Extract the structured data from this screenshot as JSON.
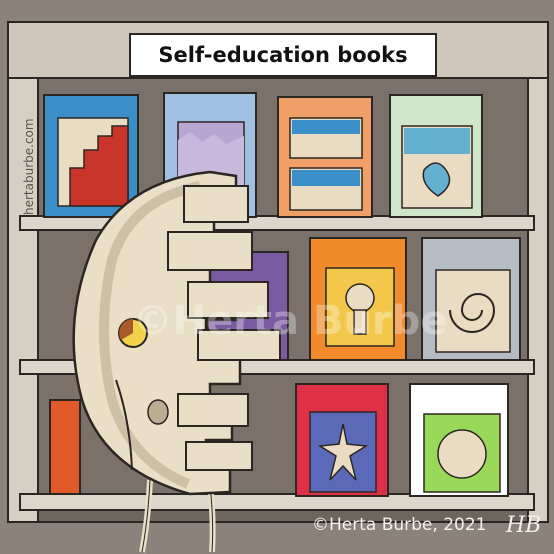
{
  "sign": {
    "title": "Self-education books"
  },
  "credits": {
    "side_url": "hertaburbe.com",
    "watermark": "©Herta Burbe",
    "copyright": "©Herta Burbe, 2021",
    "signature": "HB"
  },
  "colors": {
    "wall": "#8a827a",
    "shelf": "#d9d2c8",
    "shelf_edge": "#a79f95",
    "creature": "#e8dfc6",
    "creature_shadow": "#b9ae92",
    "outline": "#2c2622"
  }
}
